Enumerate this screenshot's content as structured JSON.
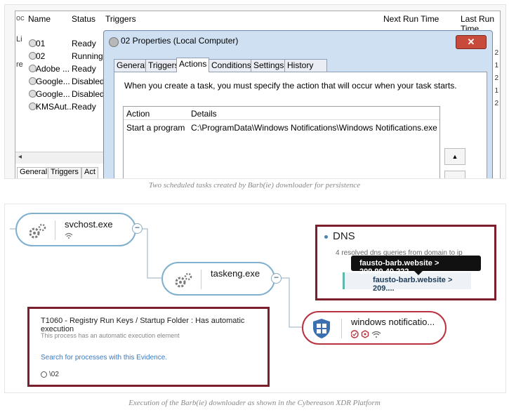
{
  "figure1": {
    "task_scheduler": {
      "columns": [
        "Name",
        "Status",
        "Triggers",
        "Next Run Time",
        "Last Run Time"
      ],
      "left_cut": [
        "oc",
        "Li",
        "re"
      ],
      "tasks": [
        {
          "name": "01",
          "status": "Ready"
        },
        {
          "name": "02",
          "status": "Running"
        },
        {
          "name": "Adobe ...",
          "status": "Ready"
        },
        {
          "name": "Google...",
          "status": "Disabled"
        },
        {
          "name": "Google...",
          "status": "Disabled"
        },
        {
          "name": "KMSAut...",
          "status": "Ready"
        }
      ],
      "right_cut": [
        "2",
        "1",
        "2",
        "1",
        "2"
      ],
      "bottom_tabs": [
        "General",
        "Triggers",
        "Act"
      ]
    },
    "dialog": {
      "title": "02 Properties (Local Computer)",
      "close": "✕",
      "tabs": [
        "General",
        "Triggers",
        "Actions",
        "Conditions",
        "Settings",
        "History (disabled)"
      ],
      "active_tab": "Actions",
      "description": "When you create a task, you must specify the action that will occur when your task starts.",
      "table_headers": [
        "Action",
        "Details"
      ],
      "rows": [
        {
          "action": "Start a program",
          "details": "C:\\ProgramData\\Windows Notifications\\Windows Notifications.exe"
        }
      ]
    },
    "caption": "Two scheduled tasks created by Barb(ie) downloader for persistence"
  },
  "figure2": {
    "nodes": {
      "svchost": "svchost.exe",
      "taskeng": "taskeng.exe",
      "winnotif": "windows notificatio..."
    },
    "dns": {
      "title": "DNS",
      "subtitle": "4 resolved dns queries from domain to ip",
      "entry": "fausto-barb.website > 209...."
    },
    "tooltip": "fausto-barb.website > 209.99.40.222",
    "evidence": {
      "title": "T1060 - Registry Run Keys / Startup Folder : Has automatic execution",
      "subtitle": "This process has an automatic execution element",
      "link": "Search for processes with this Evidence.",
      "footer": "\\02"
    },
    "caption": "Execution of the Barb(ie) downloader as shown in the Cybereason XDR Platform",
    "colors": {
      "highlight_border": "#7a1f2b",
      "node_border": "#7fb0cf",
      "malicious_border": "#b8323f"
    }
  }
}
